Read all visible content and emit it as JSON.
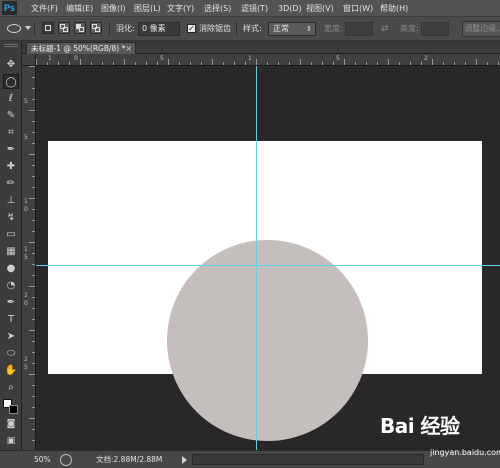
{
  "app": {
    "logo": "Ps"
  },
  "menu": {
    "items": [
      "文件(F)",
      "编辑(E)",
      "图像(I)",
      "图层(L)",
      "文字(Y)",
      "选择(S)",
      "滤镜(T)",
      "3D(D)",
      "视图(V)",
      "窗口(W)",
      "帮助(H)"
    ]
  },
  "options": {
    "feather_label": "羽化:",
    "feather_value": "0 像素",
    "antialias_label": "消除锯齿",
    "antialias_checked": true,
    "style_label": "样式:",
    "style_value": "正常",
    "width_label": "宽度:",
    "height_label": "高度:",
    "refine_edge_label": "调整边缘..."
  },
  "document_tab": {
    "title": "未标题-1 @ 50%(RGB/8) *",
    "close_glyph": "×"
  },
  "rulers": {
    "top_ticks": [
      "1",
      "0",
      "5",
      "1",
      "5",
      "2"
    ],
    "left_ticks": [
      "5",
      "5",
      "1",
      "0",
      "1",
      "5",
      "2",
      "0",
      "2",
      "5"
    ]
  },
  "canvas": {
    "background_color": "#ffffff",
    "shape_color": "#c5bfbb",
    "guide_color": "#5ed0ea"
  },
  "status": {
    "zoom": "50%",
    "doc_size": "文档:2.88M/2.88M"
  },
  "watermark": {
    "logo_text": "Bai 经验",
    "url": "jingyan.baidu.com"
  }
}
